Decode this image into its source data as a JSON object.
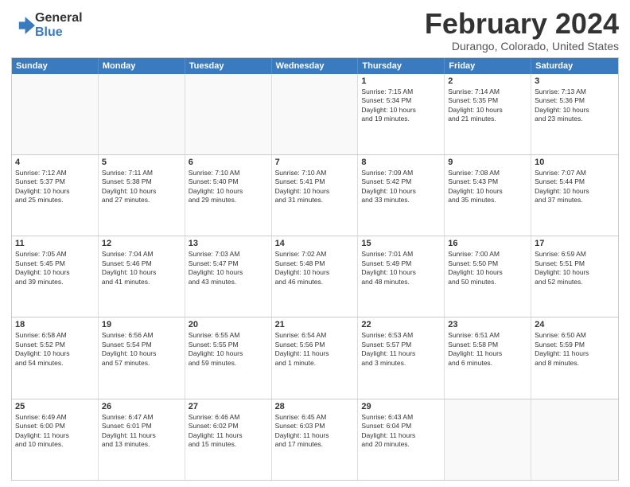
{
  "header": {
    "logo_line1": "General",
    "logo_line2": "Blue",
    "month_title": "February 2024",
    "location": "Durango, Colorado, United States"
  },
  "days_of_week": [
    "Sunday",
    "Monday",
    "Tuesday",
    "Wednesday",
    "Thursday",
    "Friday",
    "Saturday"
  ],
  "weeks": [
    [
      {
        "day": "",
        "text": ""
      },
      {
        "day": "",
        "text": ""
      },
      {
        "day": "",
        "text": ""
      },
      {
        "day": "",
        "text": ""
      },
      {
        "day": "1",
        "text": "Sunrise: 7:15 AM\nSunset: 5:34 PM\nDaylight: 10 hours\nand 19 minutes."
      },
      {
        "day": "2",
        "text": "Sunrise: 7:14 AM\nSunset: 5:35 PM\nDaylight: 10 hours\nand 21 minutes."
      },
      {
        "day": "3",
        "text": "Sunrise: 7:13 AM\nSunset: 5:36 PM\nDaylight: 10 hours\nand 23 minutes."
      }
    ],
    [
      {
        "day": "4",
        "text": "Sunrise: 7:12 AM\nSunset: 5:37 PM\nDaylight: 10 hours\nand 25 minutes."
      },
      {
        "day": "5",
        "text": "Sunrise: 7:11 AM\nSunset: 5:38 PM\nDaylight: 10 hours\nand 27 minutes."
      },
      {
        "day": "6",
        "text": "Sunrise: 7:10 AM\nSunset: 5:40 PM\nDaylight: 10 hours\nand 29 minutes."
      },
      {
        "day": "7",
        "text": "Sunrise: 7:10 AM\nSunset: 5:41 PM\nDaylight: 10 hours\nand 31 minutes."
      },
      {
        "day": "8",
        "text": "Sunrise: 7:09 AM\nSunset: 5:42 PM\nDaylight: 10 hours\nand 33 minutes."
      },
      {
        "day": "9",
        "text": "Sunrise: 7:08 AM\nSunset: 5:43 PM\nDaylight: 10 hours\nand 35 minutes."
      },
      {
        "day": "10",
        "text": "Sunrise: 7:07 AM\nSunset: 5:44 PM\nDaylight: 10 hours\nand 37 minutes."
      }
    ],
    [
      {
        "day": "11",
        "text": "Sunrise: 7:05 AM\nSunset: 5:45 PM\nDaylight: 10 hours\nand 39 minutes."
      },
      {
        "day": "12",
        "text": "Sunrise: 7:04 AM\nSunset: 5:46 PM\nDaylight: 10 hours\nand 41 minutes."
      },
      {
        "day": "13",
        "text": "Sunrise: 7:03 AM\nSunset: 5:47 PM\nDaylight: 10 hours\nand 43 minutes."
      },
      {
        "day": "14",
        "text": "Sunrise: 7:02 AM\nSunset: 5:48 PM\nDaylight: 10 hours\nand 46 minutes."
      },
      {
        "day": "15",
        "text": "Sunrise: 7:01 AM\nSunset: 5:49 PM\nDaylight: 10 hours\nand 48 minutes."
      },
      {
        "day": "16",
        "text": "Sunrise: 7:00 AM\nSunset: 5:50 PM\nDaylight: 10 hours\nand 50 minutes."
      },
      {
        "day": "17",
        "text": "Sunrise: 6:59 AM\nSunset: 5:51 PM\nDaylight: 10 hours\nand 52 minutes."
      }
    ],
    [
      {
        "day": "18",
        "text": "Sunrise: 6:58 AM\nSunset: 5:52 PM\nDaylight: 10 hours\nand 54 minutes."
      },
      {
        "day": "19",
        "text": "Sunrise: 6:56 AM\nSunset: 5:54 PM\nDaylight: 10 hours\nand 57 minutes."
      },
      {
        "day": "20",
        "text": "Sunrise: 6:55 AM\nSunset: 5:55 PM\nDaylight: 10 hours\nand 59 minutes."
      },
      {
        "day": "21",
        "text": "Sunrise: 6:54 AM\nSunset: 5:56 PM\nDaylight: 11 hours\nand 1 minute."
      },
      {
        "day": "22",
        "text": "Sunrise: 6:53 AM\nSunset: 5:57 PM\nDaylight: 11 hours\nand 3 minutes."
      },
      {
        "day": "23",
        "text": "Sunrise: 6:51 AM\nSunset: 5:58 PM\nDaylight: 11 hours\nand 6 minutes."
      },
      {
        "day": "24",
        "text": "Sunrise: 6:50 AM\nSunset: 5:59 PM\nDaylight: 11 hours\nand 8 minutes."
      }
    ],
    [
      {
        "day": "25",
        "text": "Sunrise: 6:49 AM\nSunset: 6:00 PM\nDaylight: 11 hours\nand 10 minutes."
      },
      {
        "day": "26",
        "text": "Sunrise: 6:47 AM\nSunset: 6:01 PM\nDaylight: 11 hours\nand 13 minutes."
      },
      {
        "day": "27",
        "text": "Sunrise: 6:46 AM\nSunset: 6:02 PM\nDaylight: 11 hours\nand 15 minutes."
      },
      {
        "day": "28",
        "text": "Sunrise: 6:45 AM\nSunset: 6:03 PM\nDaylight: 11 hours\nand 17 minutes."
      },
      {
        "day": "29",
        "text": "Sunrise: 6:43 AM\nSunset: 6:04 PM\nDaylight: 11 hours\nand 20 minutes."
      },
      {
        "day": "",
        "text": ""
      },
      {
        "day": "",
        "text": ""
      }
    ]
  ]
}
